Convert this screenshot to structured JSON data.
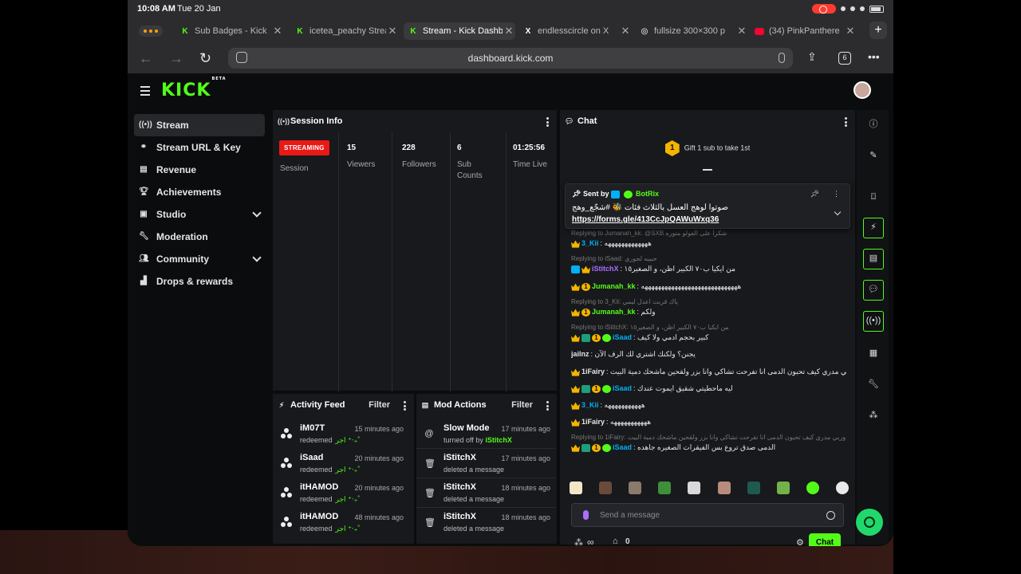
{
  "status_bar": {
    "time": "10:08 AM",
    "date": "Tue 20 Jan"
  },
  "browser": {
    "tabs": [
      {
        "label": "Sub Badges - Kick",
        "icon": "kick-icon",
        "active": false
      },
      {
        "label": "icetea_peachy Stream",
        "icon": "kick-icon",
        "active": false
      },
      {
        "label": "Stream - Kick Dashboard",
        "icon": "kick-icon",
        "active": true
      },
      {
        "label": "endlesscircle on X",
        "icon": "x-icon",
        "active": false
      },
      {
        "label": "fullsize 300×300 p",
        "icon": "globe-icon",
        "active": false
      },
      {
        "label": "(34) PinkPanthere",
        "icon": "youtube-icon",
        "active": false
      }
    ],
    "url": "dashboard.kick.com",
    "tab_count": "6"
  },
  "logo": {
    "text": "KICK",
    "beta": "BETA"
  },
  "sidebar": {
    "items": [
      {
        "label": "Stream",
        "icon": "broadcast-icon",
        "active": true
      },
      {
        "label": "Stream URL & Key",
        "icon": "link-icon"
      },
      {
        "label": "Revenue",
        "icon": "chart-icon"
      },
      {
        "label": "Achievements",
        "icon": "trophy-icon"
      },
      {
        "label": "Studio",
        "icon": "studio-icon",
        "expandable": true
      },
      {
        "label": "Moderation",
        "icon": "wrench-icon"
      },
      {
        "label": "Community",
        "icon": "community-icon",
        "expandable": true
      },
      {
        "label": "Drops & rewards",
        "icon": "drops-icon"
      }
    ]
  },
  "session": {
    "title": "Session Info",
    "status": "STREAMING",
    "session_label": "Session",
    "stats": [
      {
        "value": "15",
        "label": "Viewers"
      },
      {
        "value": "228",
        "label": "Followers"
      },
      {
        "value": "6",
        "label": "Sub Counts"
      },
      {
        "value": "01:25:56",
        "label": "Time Live"
      }
    ]
  },
  "activity": {
    "title": "Activity Feed",
    "filter": "Filter",
    "items": [
      {
        "name": "iM07T",
        "action": "redeemed",
        "reward": "اجر ⁺‧₊˚",
        "time": "15 minutes ago"
      },
      {
        "name": "iSaad",
        "action": "redeemed",
        "reward": "اجر ⁺‧₊˚",
        "time": "20 minutes ago"
      },
      {
        "name": "itHAMOD",
        "action": "redeemed",
        "reward": "اجر ⁺‧₊˚",
        "time": "20 minutes ago"
      },
      {
        "name": "itHAMOD",
        "action": "redeemed",
        "reward": "اجر ⁺‧₊˚",
        "time": "48 minutes ago"
      }
    ]
  },
  "mod_actions": {
    "title": "Mod Actions",
    "filter": "Filter",
    "items": [
      {
        "title": "Slow Mode",
        "sub": "turned off by",
        "by": "iStitchX",
        "time": "17 minutes ago",
        "icon": "snail-icon"
      },
      {
        "title": "iStitchX",
        "sub": "deleted a message",
        "by": "",
        "time": "17 minutes ago",
        "icon": "trash-icon"
      },
      {
        "title": "iStitchX",
        "sub": "deleted a message",
        "by": "",
        "time": "18 minutes ago",
        "icon": "trash-icon"
      },
      {
        "title": "iStitchX",
        "sub": "deleted a message",
        "by": "",
        "time": "18 minutes ago",
        "icon": "trash-icon"
      }
    ]
  },
  "chat": {
    "title": "Chat",
    "gift_text": "Gift 1 sub to take 1st",
    "gift_rank": "1",
    "pinned": {
      "sent_by": "Sent by",
      "bot": "BotRix",
      "text": "صوتوا لوهج العسل بالثلاث فئات 🐝 #شجّع_وهج",
      "link": "https://forms.gle/413CcJpQAWuWxq36"
    },
    "messages": [
      {
        "type": "reply",
        "text": "Replying to Jumanah_kk: @SXB شكراً على الفولو متوره"
      },
      {
        "type": "msg",
        "user": "3_Kii",
        "color": "#00b0f4",
        "text": "هههههههههههههه",
        "badges": [
          "crown"
        ]
      },
      {
        "type": "reply",
        "text": "Replying to iSaad: حبيبه لجوري"
      },
      {
        "type": "msg",
        "user": "iStitchX",
        "color": "#a970ff",
        "text": "من ايكيا ب٧٠ الكبير اظن، و الصغير١٥",
        "badges": [
          "mod",
          "crown"
        ]
      },
      {
        "type": "msg",
        "user": "Jumanah_kk",
        "color": "#53fc18",
        "text": "هههههههههههههههههههههههههههههه",
        "badges": [
          "crown",
          "one"
        ]
      },
      {
        "type": "reply",
        "text": "Replying to 3_Kii: ياك قربت اعدل ليمي"
      },
      {
        "type": "msg",
        "user": "Jumanah_kk",
        "color": "#53fc18",
        "text": "ولكم",
        "badges": [
          "crown",
          "one"
        ]
      },
      {
        "type": "reply",
        "text": "Replying to iStitchX: من ايكيا ب٧٠ الكبير اظن، و الصغير١٥"
      },
      {
        "type": "msg",
        "user": "iSaad",
        "color": "#00b0f4",
        "text": "كبير بحجم ادمي ولا كيف",
        "badges": [
          "crown",
          "og",
          "one",
          "ver"
        ]
      },
      {
        "type": "msg",
        "user": "jailnz",
        "color": "#e6e6e6",
        "text": "يجنن؟ ولكنك اشتري لك الرف الآن",
        "badges": []
      },
      {
        "type": "msg",
        "user": "1iFairy",
        "color": "#e6e6e6",
        "text": "وربي مدري كيف تحبون الدمى انا تفرحت تشاكي وانا بزر ولقحين ماشحك دمية البيت",
        "badges": [
          "crown"
        ]
      },
      {
        "type": "msg",
        "user": "iSaad",
        "color": "#00b0f4",
        "text": "ليه ماحطيتي شقيق ايموت عندك",
        "badges": [
          "crown",
          "og",
          "one",
          "ver"
        ]
      },
      {
        "type": "msg",
        "user": "3_Kii",
        "color": "#00b0f4",
        "text": "هههههههههههه",
        "badges": [
          "crown"
        ]
      },
      {
        "type": "msg",
        "user": "1iFairy",
        "color": "#e6e6e6",
        "text": "هههههههههههه",
        "badges": [
          "crown"
        ]
      },
      {
        "type": "reply",
        "text": "Replying to 1iFairy: وربي مدري كيف تحبون الدمى انا تفرحت تشاكي وانا بزر ولقحين ماشحك دمية البيت"
      },
      {
        "type": "msg",
        "user": "iSaad",
        "color": "#00b0f4",
        "text": "الدمى صدق تروع بس الفيقرات الصغيره جاهده",
        "badges": [
          "crown",
          "og",
          "one",
          "ver"
        ]
      }
    ],
    "input_placeholder": "Send a message",
    "points": "∞",
    "gift_count": "0",
    "send_label": "Chat"
  },
  "colors": {
    "accent": "#53fc18",
    "live": "#e91916",
    "panel": "#18191c",
    "background": "#0b0c0e"
  }
}
